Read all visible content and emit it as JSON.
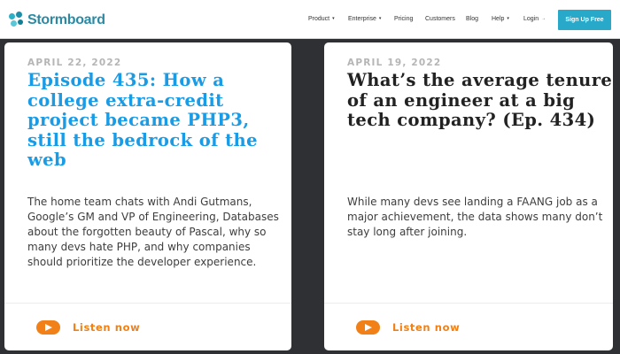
{
  "header": {
    "brand": "Stormboard",
    "nav": [
      {
        "label": "Product",
        "caret": "▾"
      },
      {
        "label": "Enterprise",
        "caret": "▾"
      },
      {
        "label": "Pricing"
      },
      {
        "label": "Customers"
      },
      {
        "label": "Blog"
      },
      {
        "label": "Help",
        "caret": "▾"
      },
      {
        "label": "Login",
        "caret": "→"
      }
    ],
    "signup_label": "Sign Up Free",
    "signup_color": "#29a9c9"
  },
  "cards": [
    {
      "date": "APRIL 22, 2022",
      "title": "Episode 435: How a college extra-credit project became PHP3, still the bedrock of the web",
      "description": "The home team chats with Andi Gutmans, Google’s GM and VP of Engineering, Databases about the forgotten beauty of Pascal, why so many devs hate PHP, and why companies should prioritize the developer experience.",
      "listen_label": "Listen now",
      "title_color": "#1a9be6"
    },
    {
      "date": "APRIL 19, 2022",
      "title": "What’s the average tenure of an engineer at a big tech company? (Ep. 434)",
      "description": "While many devs see landing a FAANG job as a major achievement, the data shows many don’t stay long after joining.",
      "listen_label": "Listen now",
      "title_color": "#222222"
    }
  ],
  "icons": {
    "logo": "stormboard-logo-icon",
    "play": "play-icon"
  },
  "accent_color": "#f08017"
}
